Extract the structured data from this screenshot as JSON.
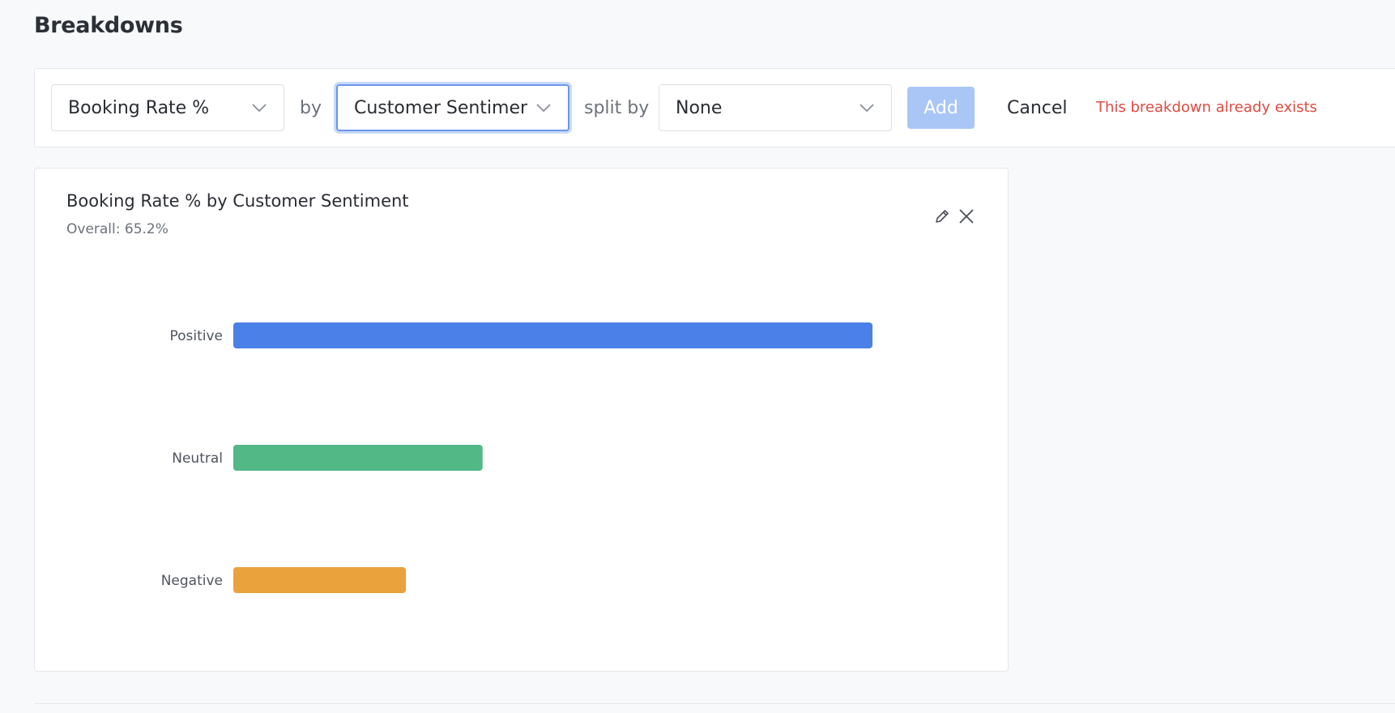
{
  "page": {
    "title": "Breakdowns"
  },
  "toolbar": {
    "metric_select": {
      "value": "Booking Rate %"
    },
    "by_label": "by",
    "dimension_select": {
      "value": "Customer Sentiment"
    },
    "split_label": "split by",
    "split_select": {
      "value": "None"
    },
    "add_label": "Add",
    "cancel_label": "Cancel",
    "error_message": "This breakdown already exists"
  },
  "card": {
    "title": "Booking Rate % by Customer Sentiment",
    "subtitle": "Overall: 65.2%",
    "edit_icon": "pencil-icon",
    "close_icon": "close-icon"
  },
  "colors": {
    "accent": "#4a80e8",
    "error": "#df4a42",
    "add_disabled": "#a9c6f6"
  },
  "chart_data": {
    "type": "bar",
    "orientation": "horizontal",
    "categories": [
      "Positive",
      "Neutral",
      "Negative"
    ],
    "values": [
      100,
      39,
      27
    ],
    "colors": [
      "#4a80e8",
      "#52b886",
      "#e9a23c"
    ],
    "xlim": [
      0,
      100
    ],
    "grid": false,
    "legend": "none",
    "title": "",
    "xlabel": "",
    "ylabel": ""
  }
}
